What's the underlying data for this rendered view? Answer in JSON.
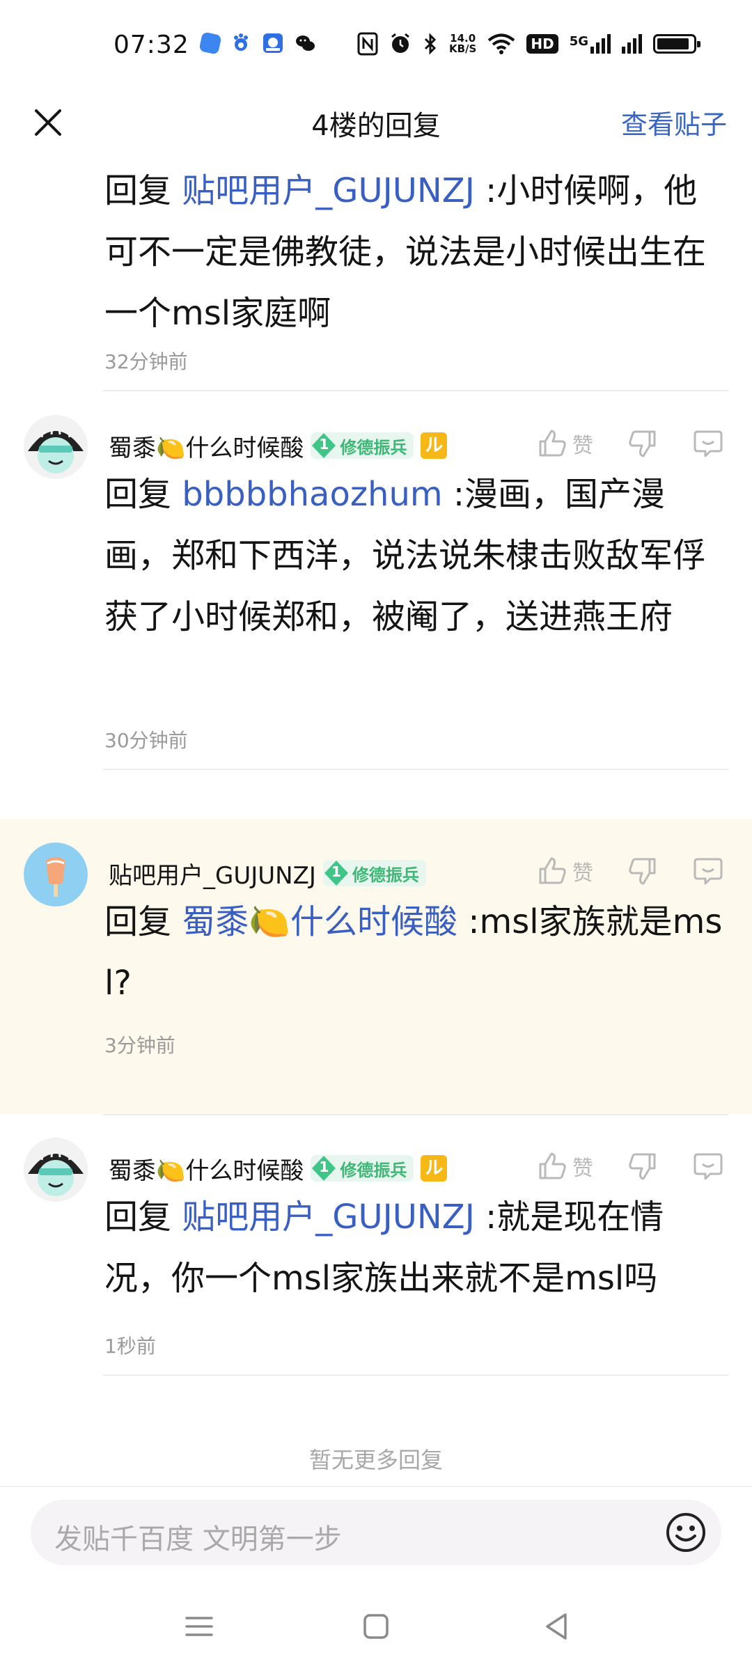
{
  "status_bar": {
    "time": "07:32",
    "net_speed": "14.0",
    "net_speed_unit": "KB/S",
    "hd_label": "HD",
    "signal_label": "5G",
    "icons": [
      "app-blue-icon",
      "baidu-icon",
      "baidu-tieba-icon",
      "wechat-icon",
      "nfc-icon",
      "alarm-icon",
      "bluetooth-icon",
      "wifi-icon",
      "signal-icon",
      "battery-icon"
    ]
  },
  "header": {
    "title": "4楼的回复",
    "view_post": "查看贴子"
  },
  "replies": [
    {
      "prefix": "回复",
      "mention": "贴吧用户_GUJUNZJ",
      "text": " :小时候啊，他可不一定是佛教徒，说法是小时候出生在一个msl家庭啊",
      "time": "32分钟前"
    },
    {
      "user": "蜀黍🍋什么时候酸",
      "level": "1",
      "badge": "修德振兵",
      "vip": "ル",
      "like_label": "赞",
      "prefix": "回复",
      "mention": "bbbbbhaozhum",
      "text": " :漫画，国产漫画，郑和下西洋，说法说朱棣击败敌军俘获了小时候郑和，被阉了，送进燕王府",
      "time": "30分钟前"
    },
    {
      "user": "贴吧用户_GUJUNZJ",
      "level": "1",
      "badge": "修德振兵",
      "like_label": "赞",
      "prefix": "回复",
      "mention": "蜀黍🍋什么时候酸",
      "text": " :msl家族就是msl?",
      "time": "3分钟前"
    },
    {
      "user": "蜀黍🍋什么时候酸",
      "level": "1",
      "badge": "修德振兵",
      "vip": "ル",
      "like_label": "赞",
      "prefix": "回复",
      "mention": "贴吧用户_GUJUNZJ",
      "text": " :就是现在情况，你一个msl家族出来就不是msl吗",
      "time": "1秒前"
    }
  ],
  "no_more": "暂无更多回复",
  "input": {
    "placeholder": "发贴千百度 文明第一步"
  },
  "colors": {
    "accent": "#3a66c2",
    "highlight_bg": "#fdf9ec",
    "badge_green": "#3fb877",
    "vip_gold": "#f5b817"
  }
}
